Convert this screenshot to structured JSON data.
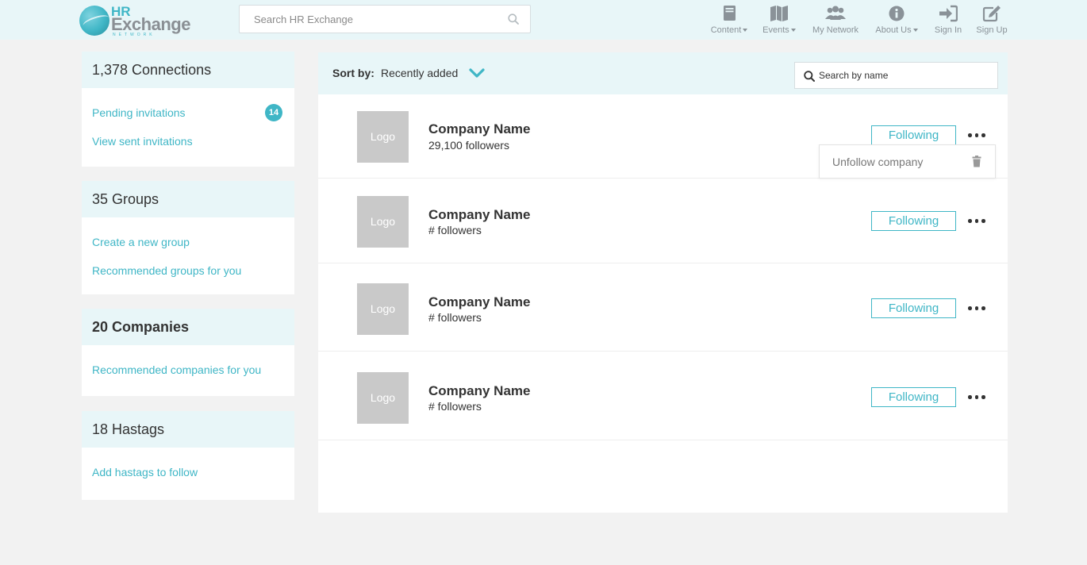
{
  "header": {
    "logo": {
      "line1": "HR",
      "line2": "Exchange",
      "line3": "NETWORK"
    },
    "search_placeholder": "Search HR Exchange",
    "nav": [
      {
        "label": "Content",
        "icon": "book-icon",
        "dropdown": true
      },
      {
        "label": "Events",
        "icon": "map-icon",
        "dropdown": true
      },
      {
        "label": "My Network",
        "icon": "users-icon",
        "dropdown": false
      },
      {
        "label": "About Us",
        "icon": "info-icon",
        "dropdown": true
      },
      {
        "label": "Sign In",
        "icon": "sign-in-icon",
        "dropdown": false
      },
      {
        "label": "Sign Up",
        "icon": "edit-icon",
        "dropdown": false
      }
    ]
  },
  "sidebar": {
    "connections": {
      "title": "1,378 Connections",
      "links": [
        "Pending invitations",
        "View sent invitations"
      ],
      "badge": "14"
    },
    "groups": {
      "title": "35 Groups",
      "links": [
        "Create a new group",
        "Recommended groups for you"
      ]
    },
    "companies": {
      "title": "20 Companies",
      "links": [
        "Recommended companies for you"
      ]
    },
    "hashtags": {
      "title": "18 Hastags",
      "links": [
        "Add hastags to follow"
      ]
    }
  },
  "main": {
    "sort_label": "Sort by:",
    "sort_value": "Recently added",
    "name_search_placeholder": "Search by name",
    "companies": [
      {
        "logo": "Logo",
        "name": "Company Name",
        "followers": "29,100 followers",
        "button": "Following"
      },
      {
        "logo": "Logo",
        "name": "Company Name",
        "followers": "# followers",
        "button": "Following"
      },
      {
        "logo": "Logo",
        "name": "Company Name",
        "followers": "# followers",
        "button": "Following"
      },
      {
        "logo": "Logo",
        "name": "Company Name",
        "followers": "# followers",
        "button": "Following"
      }
    ],
    "dropdown": {
      "label": "Unfollow company"
    }
  },
  "colors": {
    "accent": "#3fb6c6",
    "header_bg": "#e8f6f8",
    "logo_grey": "#c9c9c9",
    "page_bg": "#f2f2f2"
  }
}
